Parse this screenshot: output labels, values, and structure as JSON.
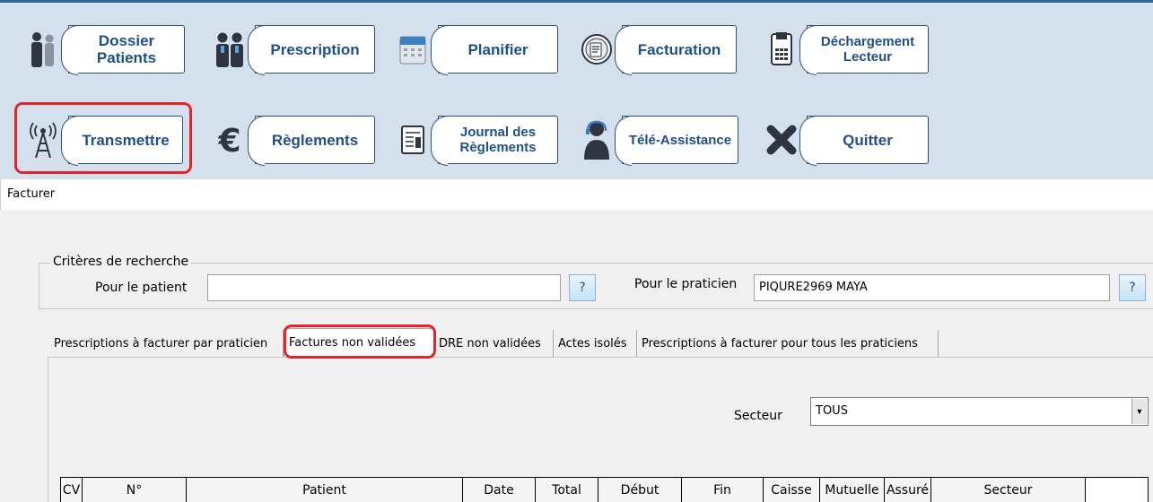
{
  "toolbar": {
    "buttons": [
      {
        "label_line1": "Dossier",
        "label_line2": "Patients",
        "icon": "patients-icon"
      },
      {
        "label_line1": "Prescription",
        "icon": "prescription-icon"
      },
      {
        "label_line1": "Planifier",
        "icon": "calendar-icon"
      },
      {
        "label_line1": "Facturation",
        "icon": "invoice-icon"
      },
      {
        "label_line1": "Déchargement",
        "label_line2": "Lecteur",
        "icon": "card-reader-icon"
      },
      {
        "label_line1": "Transmettre",
        "icon": "antenna-icon"
      },
      {
        "label_line1": "Règlements",
        "icon": "euro-icon"
      },
      {
        "label_line1": "Journal des",
        "label_line2": "Règlements",
        "icon": "journal-icon"
      },
      {
        "label_line1": "Télé-Assistance",
        "icon": "support-agent-icon"
      },
      {
        "label_line1": "Quitter",
        "icon": "close-x-icon"
      }
    ]
  },
  "window": {
    "title": "Facturer"
  },
  "criteria": {
    "legend": "Critères de recherche",
    "patient_label": "Pour le patient",
    "patient_value": "",
    "praticien_label": "Pour le praticien",
    "praticien_value": "PIQURE2969 MAYA",
    "help_label": "?"
  },
  "tabs": [
    {
      "label": "Prescriptions à facturer par praticien"
    },
    {
      "label": "Factures non validées"
    },
    {
      "label": "DRE non validées"
    },
    {
      "label": "Actes isolés"
    },
    {
      "label": "Prescriptions à facturer pour tous les praticiens"
    }
  ],
  "active_tab": "Factures non validées",
  "secteur": {
    "label": "Secteur",
    "value": "TOUS"
  },
  "table": {
    "columns": [
      "CV",
      "N°",
      "Patient",
      "Date",
      "Total",
      "Début",
      "Fin",
      "Caisse",
      "Mutuelle",
      "Assuré",
      "Secteur"
    ]
  },
  "colors": {
    "toolbar_bg": "#d4e0ec",
    "button_text": "#1f4f86",
    "highlight": "#e3242b"
  }
}
